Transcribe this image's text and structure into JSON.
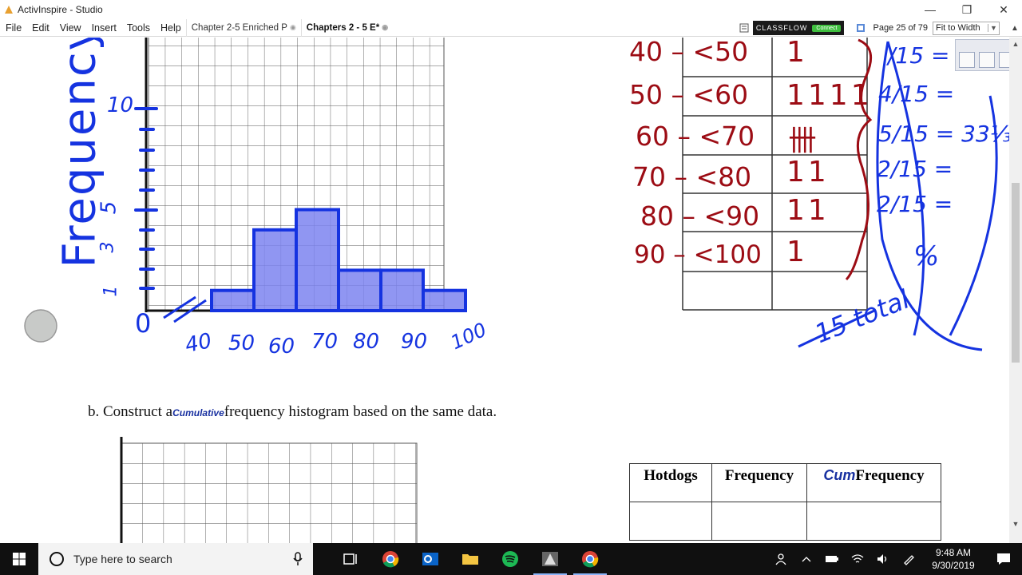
{
  "window": {
    "title": "ActivInspire - Studio"
  },
  "menu": {
    "items": [
      "File",
      "Edit",
      "View",
      "Insert",
      "Tools",
      "Help"
    ],
    "tabs": [
      {
        "label": "Chapter 2-5 Enriched P"
      },
      {
        "label": "Chapters 2 - 5 E*"
      }
    ],
    "classflow_label": "CLASSFLOW",
    "classflow_connect": "Connect",
    "page_indicator": "Page 25 of 79",
    "zoom": "Fit to Width"
  },
  "page": {
    "problem_b_prefix": "b.  Construct a",
    "problem_b_ink": "Cumulative",
    "problem_b_suffix": "frequency histogram based on the same data.",
    "table": {
      "headers": [
        "Hotdogs",
        "Frequency",
        "Frequency"
      ],
      "cum_ink": "Cum"
    }
  },
  "annotations": {
    "y_axis_label": "Frequency",
    "y_ticks": [
      "10",
      "5",
      "3",
      "1"
    ],
    "zero": "0",
    "x_ticks": [
      "40",
      "50",
      "60",
      "70",
      "80",
      "90",
      "100"
    ],
    "ranges": [
      "40 – <50",
      "50 – <60",
      "60 – <70",
      "70 – <80",
      "80 – <90",
      "90 – <100"
    ],
    "tallies": [
      "1",
      "1111",
      "卌",
      "11",
      "11",
      "1"
    ],
    "fractions": [
      "/15 =",
      "4/15 =",
      "5/15 = 33⅓",
      "2/15 =",
      "2/15 =",
      "%"
    ],
    "total_note": "15 total"
  },
  "chart_data": {
    "type": "bar",
    "categories": [
      "40-<50",
      "50-<60",
      "60-<70",
      "70-<80",
      "80-<90",
      "90-<100"
    ],
    "values": [
      1,
      4,
      5,
      2,
      2,
      1
    ],
    "xlabel": "",
    "ylabel": "Frequency"
  },
  "taskbar": {
    "search_placeholder": "Type here to search",
    "time": "9:48 AM",
    "date": "9/30/2019"
  },
  "colors": {
    "ink_blue": "#1533e0",
    "ink_red": "#9c0c14",
    "bar_fill": "#7c84f0"
  }
}
